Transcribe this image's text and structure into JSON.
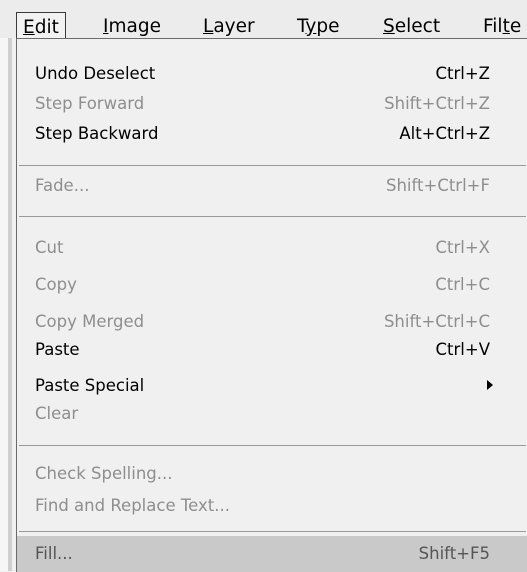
{
  "menubar": {
    "items": [
      {
        "prefix": "",
        "mnemonic": "E",
        "rest": "dit"
      },
      {
        "prefix": "",
        "mnemonic": "I",
        "rest": "mage"
      },
      {
        "prefix": "",
        "mnemonic": "L",
        "rest": "ayer"
      },
      {
        "prefix": "T",
        "mnemonic": "y",
        "rest": "pe"
      },
      {
        "prefix": "",
        "mnemonic": "S",
        "rest": "elect"
      },
      {
        "prefix": "Fil",
        "mnemonic": "t",
        "rest": "e"
      }
    ]
  },
  "edit_menu": {
    "items": [
      {
        "label": "Undo Deselect",
        "shortcut": "Ctrl+Z",
        "state": "enabled"
      },
      {
        "label": "Step Forward",
        "shortcut": "Shift+Ctrl+Z",
        "state": "disabled"
      },
      {
        "label": "Step Backward",
        "shortcut": "Alt+Ctrl+Z",
        "state": "enabled"
      },
      {
        "label": "Fade...",
        "shortcut": "Shift+Ctrl+F",
        "state": "disabled"
      },
      {
        "label": "Cut",
        "shortcut": "Ctrl+X",
        "state": "disabled"
      },
      {
        "label": "Copy",
        "shortcut": "Ctrl+C",
        "state": "disabled"
      },
      {
        "label": "Copy Merged",
        "shortcut": "Shift+Ctrl+C",
        "state": "disabled"
      },
      {
        "label": "Paste",
        "shortcut": "Ctrl+V",
        "state": "enabled"
      },
      {
        "label": "Paste Special",
        "shortcut": "",
        "state": "enabled",
        "submenu_icon": "submenu-arrow-icon"
      },
      {
        "label": "Clear",
        "shortcut": "",
        "state": "disabled"
      },
      {
        "label": "Check Spelling...",
        "shortcut": "",
        "state": "disabled"
      },
      {
        "label": "Find and Replace Text...",
        "shortcut": "",
        "state": "disabled"
      },
      {
        "label": "Fill...",
        "shortcut": "Shift+F5",
        "state": "highlighted"
      }
    ]
  }
}
